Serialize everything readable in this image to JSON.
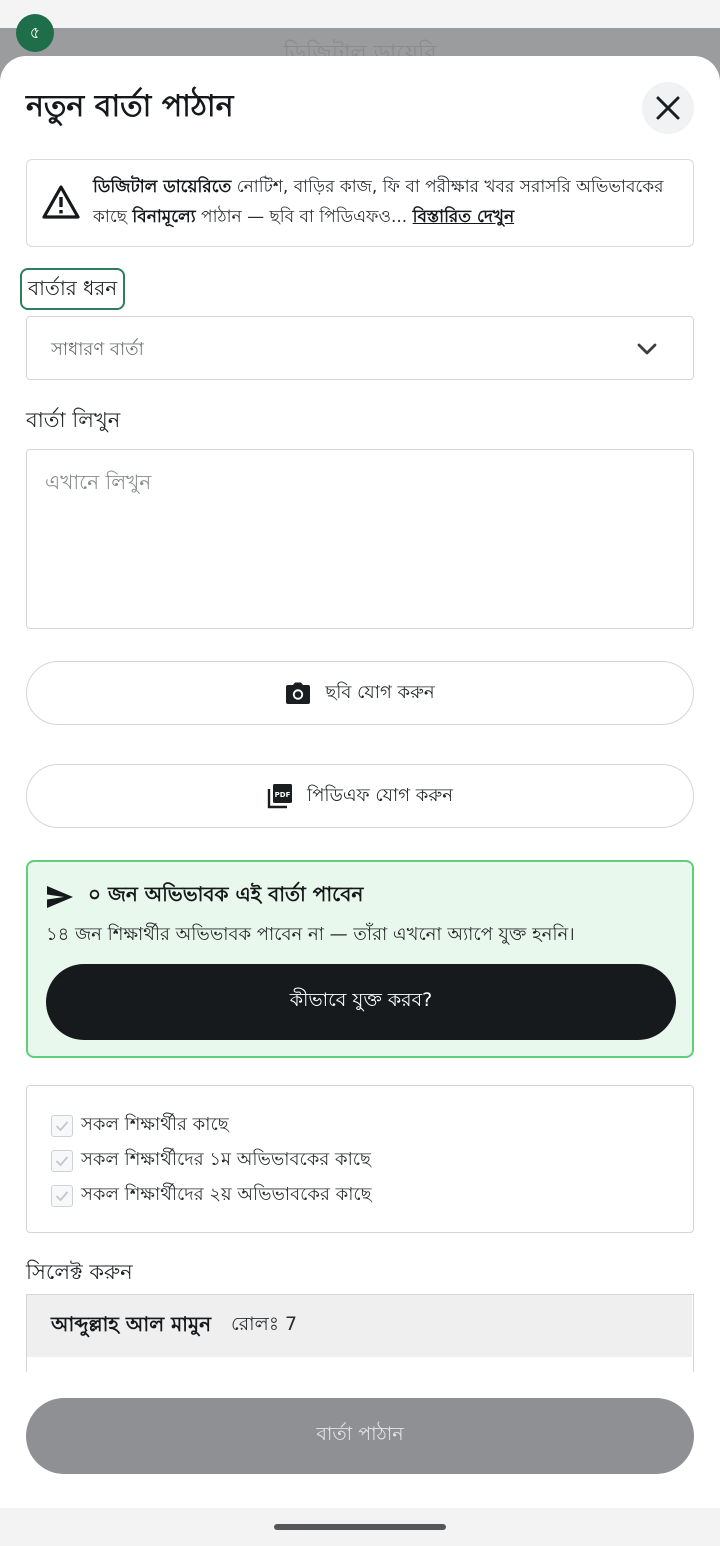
{
  "status_bar": {
    "badge": "৫"
  },
  "background": {
    "title": "ডিজিটাল ডায়েরি"
  },
  "dialog": {
    "title": "নতুন বার্তা পাঠান",
    "notice": {
      "bold_start": "ডিজিটাল ডায়েরিতে",
      "text_1": " নোটিশ, বাড়ির কাজ, ফি বা পরীক্ষার খবর সরাসরি অভিভাবকের কাছে ",
      "bold_free": "বিনামূল্যে",
      "text_2": " পাঠান — ছবি বা পিডিএফও... ",
      "link": "বিস্তারিত দেখুন"
    },
    "message_type": {
      "label": "বার্তার ধরন",
      "selected": "সাধারণ বার্তা"
    },
    "message": {
      "label": "বার্তা লিখুন",
      "placeholder": "এখানে লিখুন"
    },
    "add_photo": "ছবি যোগ করুন",
    "add_pdf": "পিডিএফ যোগ করুন",
    "recipients": {
      "count_text": "০ জন অভিভাবক এই বার্তা পাবেন",
      "sub_text": "১৪ জন শিক্ষার্থীর অভিভাবক পাবেন না — তাঁরা এখনো অ্যাপে যুক্ত হননি।",
      "how_button": "কীভাবে যুক্ত করব?"
    },
    "options": [
      {
        "label": "সকল শিক্ষার্থীর কাছে",
        "checked": true
      },
      {
        "label": "সকল শিক্ষার্থীদের ১ম অভিভাবকের কাছে",
        "checked": true
      },
      {
        "label": "সকল শিক্ষার্থীদের ২য় অভিভাবকের কাছে",
        "checked": true
      }
    ],
    "select_label": "সিলেক্ট করুন",
    "students": [
      {
        "name": "আব্দুল্লাহ আল মামুন",
        "roll": "রোলঃ 7"
      }
    ],
    "send_button": "বার্তা পাঠান"
  },
  "colors": {
    "accent_green": "#2e7d5b",
    "recipients_bg": "#e9f8ec",
    "recipients_border": "#5fcf7d",
    "dark_button": "#161a1d",
    "disabled_button": "#8e9093"
  },
  "icons": [
    "close-icon",
    "warning-icon",
    "chevron-down-icon",
    "camera-icon",
    "pdf-icon",
    "send-icon",
    "check-icon"
  ]
}
